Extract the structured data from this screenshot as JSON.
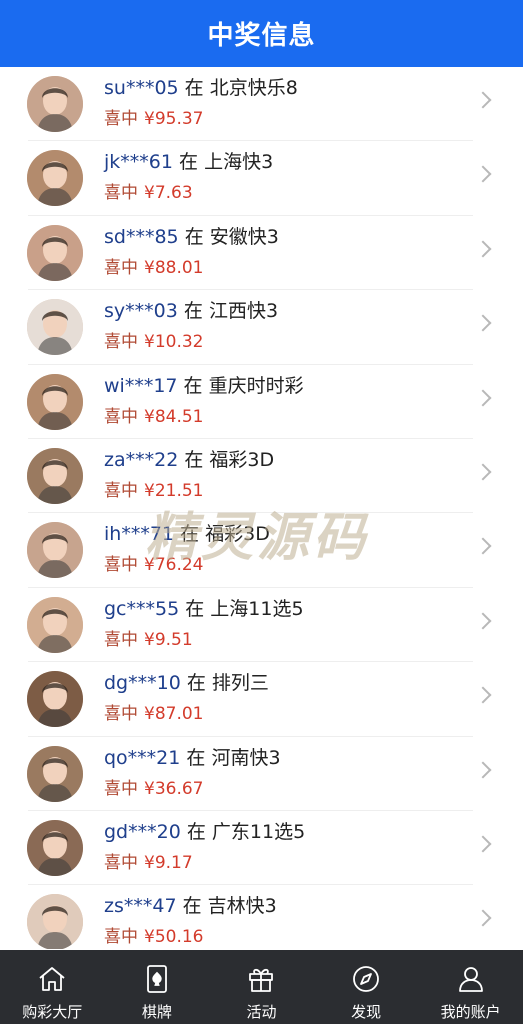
{
  "header": {
    "title": "中奖信息"
  },
  "winners": {
    "connector": "在",
    "win_label": "喜中",
    "items": [
      {
        "user": "su***05",
        "lottery": "北京快乐8",
        "amount": "¥95.37",
        "avatar_color": "#c7a48e"
      },
      {
        "user": "jk***61",
        "lottery": "上海快3",
        "amount": "¥7.63",
        "avatar_color": "#b38b6d"
      },
      {
        "user": "sd***85",
        "lottery": "安徽快3",
        "amount": "¥88.01",
        "avatar_color": "#c9a089"
      },
      {
        "user": "sy***03",
        "lottery": "江西快3",
        "amount": "¥10.32",
        "avatar_color": "#e6ddd6"
      },
      {
        "user": "wi***17",
        "lottery": "重庆时时彩",
        "amount": "¥84.51",
        "avatar_color": "#b38b6d"
      },
      {
        "user": "za***22",
        "lottery": "福彩3D",
        "amount": "¥21.51",
        "avatar_color": "#9a7a60"
      },
      {
        "user": "ih***71",
        "lottery": "福彩3D",
        "amount": "¥76.24",
        "avatar_color": "#c7a48e"
      },
      {
        "user": "gc***55",
        "lottery": "上海11选5",
        "amount": "¥9.51",
        "avatar_color": "#d2ad91"
      },
      {
        "user": "dg***10",
        "lottery": "排列三",
        "amount": "¥87.01",
        "avatar_color": "#7d5c45"
      },
      {
        "user": "qo***21",
        "lottery": "河南快3",
        "amount": "¥36.67",
        "avatar_color": "#9a7a60"
      },
      {
        "user": "gd***20",
        "lottery": "广东11选5",
        "amount": "¥9.17",
        "avatar_color": "#8a6a55"
      },
      {
        "user": "zs***47",
        "lottery": "吉林快3",
        "amount": "¥50.16",
        "avatar_color": "#e0cbbb"
      }
    ]
  },
  "watermark": "精灵源码",
  "tabbar": {
    "items": [
      {
        "label": "购彩大厅",
        "icon": "home-icon"
      },
      {
        "label": "棋牌",
        "icon": "card-icon"
      },
      {
        "label": "活动",
        "icon": "gift-icon"
      },
      {
        "label": "发现",
        "icon": "compass-icon"
      },
      {
        "label": "我的账户",
        "icon": "user-icon"
      }
    ]
  }
}
